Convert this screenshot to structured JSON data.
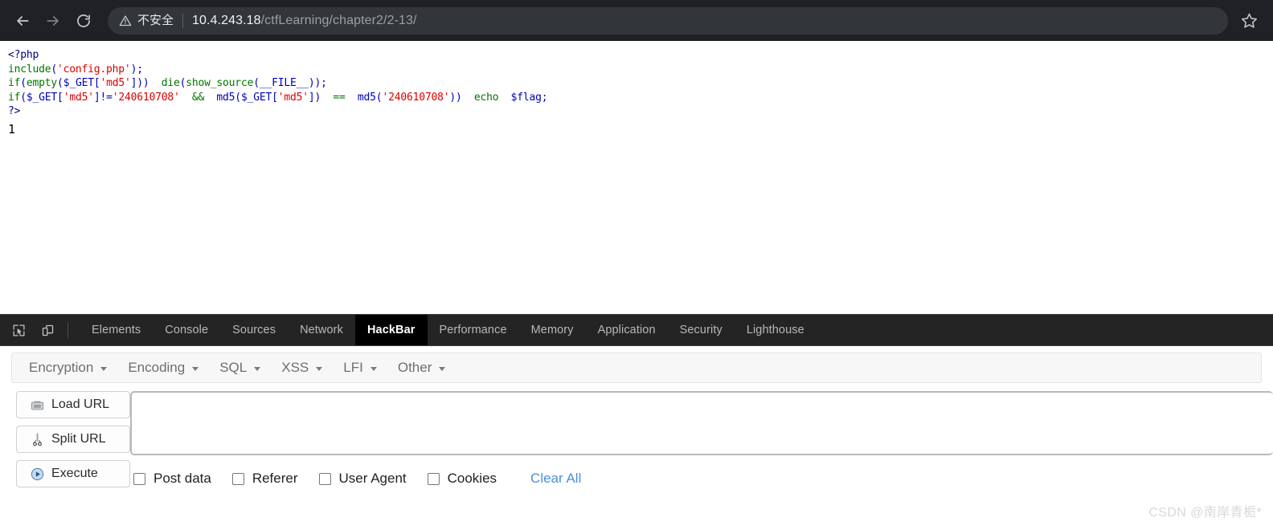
{
  "browser": {
    "nav": {
      "back_label": "Back",
      "forward_label": "Forward",
      "reload_label": "Reload"
    },
    "security_text": "不安全",
    "url_host": "10.4.243.18",
    "url_path": "/ctfLearning/chapter2/2-13/",
    "bookmark_label": "Bookmark this page"
  },
  "page": {
    "code_lines": [
      {
        "text": "<?php",
        "color": "tag"
      },
      {
        "text": "include('config.php');",
        "color": "mixed"
      },
      {
        "text": "if(empty($_GET['md5']))  die(show_source(__FILE__));",
        "color": "mixed"
      },
      {
        "text": "if($_GET['md5']!='240610708'  &&  md5($_GET['md5'])  ==  md5('240610708'))  echo  $flag;",
        "color": "mixed"
      },
      {
        "text": "?>",
        "color": "tag"
      }
    ],
    "output": "1"
  },
  "devtools": {
    "icons": {
      "inspect": "inspect-element-icon",
      "device": "device-toolbar-icon"
    },
    "tabs": [
      {
        "label": "Elements",
        "active": false
      },
      {
        "label": "Console",
        "active": false
      },
      {
        "label": "Sources",
        "active": false
      },
      {
        "label": "Network",
        "active": false
      },
      {
        "label": "HackBar",
        "active": true
      },
      {
        "label": "Performance",
        "active": false
      },
      {
        "label": "Memory",
        "active": false
      },
      {
        "label": "Application",
        "active": false
      },
      {
        "label": "Security",
        "active": false
      },
      {
        "label": "Lighthouse",
        "active": false
      }
    ]
  },
  "hackbar": {
    "menus": [
      {
        "label": "Encryption"
      },
      {
        "label": "Encoding"
      },
      {
        "label": "SQL"
      },
      {
        "label": "XSS"
      },
      {
        "label": "LFI"
      },
      {
        "label": "Other"
      }
    ],
    "buttons": [
      {
        "label": "Load URL",
        "icon": "load-url-icon"
      },
      {
        "label": "Split URL",
        "icon": "scissors-icon"
      },
      {
        "label": "Execute",
        "icon": "play-icon"
      }
    ],
    "url_field": {
      "value": "",
      "placeholder": ""
    },
    "checkboxes": [
      {
        "label": "Post data",
        "checked": false
      },
      {
        "label": "Referer",
        "checked": false
      },
      {
        "label": "User Agent",
        "checked": false
      },
      {
        "label": "Cookies",
        "checked": false
      }
    ],
    "clear_all_label": "Clear All",
    "accent_link_color": "#4a90d9"
  },
  "watermark": "CSDN @南岸青栀*"
}
